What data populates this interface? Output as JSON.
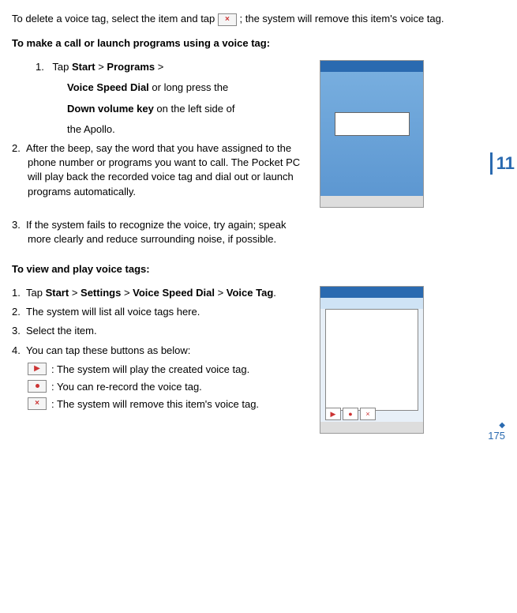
{
  "intro": {
    "l1a": "To delete a voice tag, select the item and tap ",
    "l1b": " ; the system will remove this item's voice tag."
  },
  "h1": "To make a call or launch programs using a voice tag:",
  "s1": {
    "step1_pre": "Tap ",
    "start": "Start",
    "gt": " > ",
    "programs": "Programs",
    "gt2": " >",
    "line2a": "Voice Speed Dial",
    "line2b": " or long press the",
    "line3a": "Down volume key",
    "line3b": " on the left side of",
    "line4": "the Apollo.",
    "step2": "After the beep, say the word that you have assigned to the phone number or programs you want to call. The Pocket PC will play back the recorded voice tag and dial out or launch programs automatically.",
    "step3": "If the system fails to recognize the voice, try again; speak more clearly and reduce surrounding noise, if possible."
  },
  "h2": "To view and play voice tags:",
  "s2": {
    "step1_pre": "Tap ",
    "start": "Start",
    "gt": " > ",
    "settings": "Settings",
    "vsd": "Voice Speed Dial",
    "vt": "Voice Tag",
    "dot": ".",
    "step2": "The system will list all voice tags here.",
    "step3": "Select the item.",
    "step4": "You can tap these buttons as below:",
    "play": ": The system will play the created voice tag.",
    "record": ": You can re-record the voice tag.",
    "delete": ": The system will remove this item's voice tag."
  },
  "side": "11",
  "page": "175",
  "nums": {
    "n1": "1.",
    "n2": "2.",
    "n3": "3.",
    "n4": "4."
  }
}
